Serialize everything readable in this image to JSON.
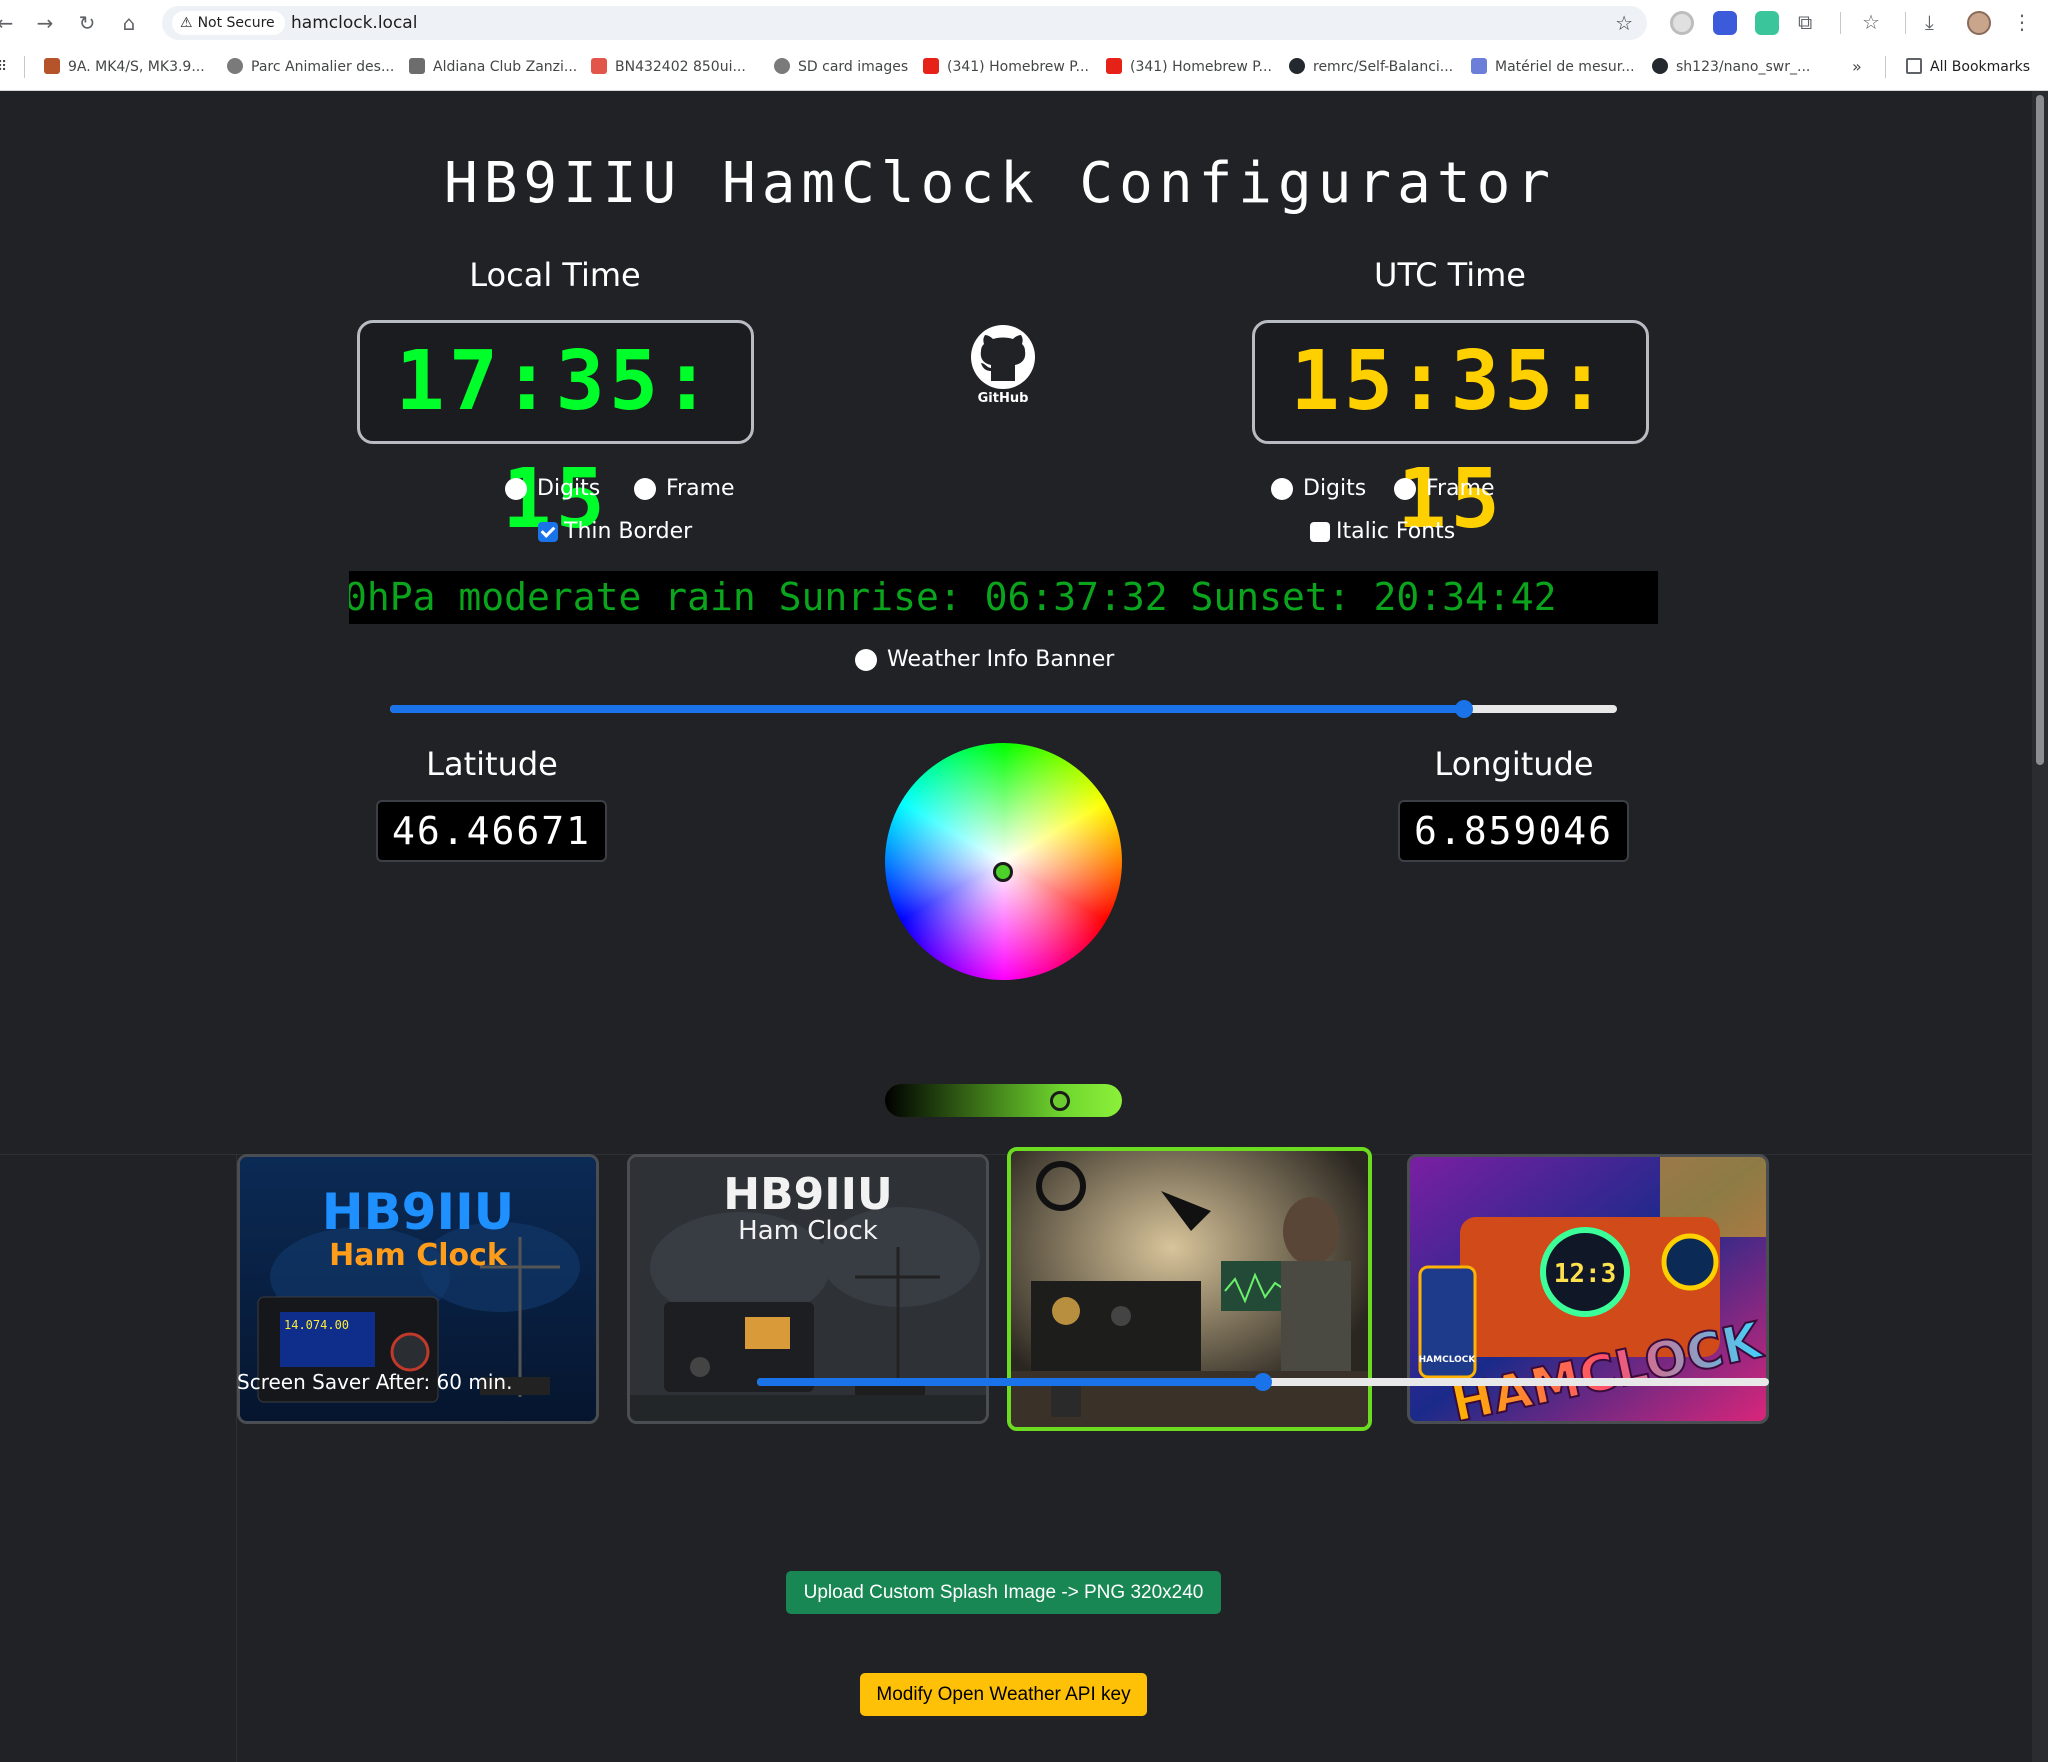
{
  "browser": {
    "security_label": "Not Secure",
    "url": "hamclock.local",
    "bookmarks": [
      {
        "label": "9A. MK4/S, MK3.9...",
        "color": "#b5542a"
      },
      {
        "label": "Parc Animalier des...",
        "color": "#7a7a7a"
      },
      {
        "label": "Aldiana Club Zanzi...",
        "color": "#6d6d6d"
      },
      {
        "label": "BN432402 850ui...",
        "color": "#e2564a"
      },
      {
        "label": "SD card images",
        "color": "#7a7a7a"
      },
      {
        "label": "(341) Homebrew P...",
        "color": "#e62117"
      },
      {
        "label": "(341) Homebrew P...",
        "color": "#e62117"
      },
      {
        "label": "remrc/Self-Balanci...",
        "color": "#24292f"
      },
      {
        "label": "Matériel de mesur...",
        "color": "#6c7fd8"
      },
      {
        "label": "sh123/nano_swr_...",
        "color": "#24292f"
      }
    ],
    "more_label": "»",
    "all_bookmarks_label": "All Bookmarks"
  },
  "page": {
    "title": "HB9IIU HamClock Configurator",
    "local": {
      "label": "Local Time",
      "time": "17:35: 15",
      "digits_label": "Digits",
      "frame_label": "Frame",
      "thin_border_label": "Thin Border",
      "thin_border_checked": true
    },
    "utc": {
      "label": "UTC Time",
      "time": "15:35: 15",
      "digits_label": "Digits",
      "frame_label": "Frame",
      "italic_label": "Italic Fonts",
      "italic_checked": false
    },
    "github_label": "GitHub",
    "banner_text": "0hPa moderate rain Sunrise: 06:37:32 Sunset: 20:34:42",
    "weather_banner_label": "Weather Info Banner",
    "scroll_speed_fraction": 0.875,
    "latitude": {
      "label": "Latitude",
      "value": "46.46671"
    },
    "longitude": {
      "label": "Longitude",
      "value": "6.859046"
    },
    "color_picker": {
      "selected_color": "#4bd12a",
      "brightness_fraction": 0.75
    },
    "splash_images": [
      {
        "title": "HB9IIU",
        "subtitle": "Ham Clock",
        "freq": "14.074.00",
        "selected": false
      },
      {
        "title": "HB9IIU",
        "subtitle": "Ham Clock",
        "selected": false
      },
      {
        "title": "",
        "selected": true
      },
      {
        "title": "HAMCLOCK",
        "display": "12:3",
        "badge": "HAMCLOCK",
        "selected": false
      }
    ],
    "screensaver": {
      "label": "Screen Saver After: 60 min.",
      "fraction": 0.5
    },
    "upload_button": "Upload Custom Splash Image -> PNG 320x240",
    "weather_key_button": "Modify Open Weather API key",
    "colors": {
      "local_digits": "#00ff2a",
      "utc_digits": "#ffd000",
      "banner_text": "#0aa51c",
      "accent": "#1a73e8",
      "selected_border": "#6cdc20"
    }
  }
}
